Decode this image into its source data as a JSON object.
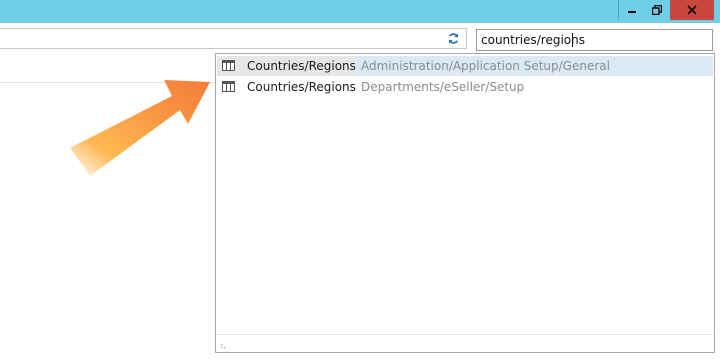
{
  "window": {
    "accent_color": "#6fcde6",
    "close_color": "#c9473e",
    "buttons": [
      "minimize-icon",
      "restore-icon",
      "close-icon"
    ]
  },
  "search": {
    "value": "countries/regions"
  },
  "results": [
    {
      "label": "Countries/Regions",
      "path": "Administration/Application Setup/General",
      "icon": "table-icon",
      "selected": true
    },
    {
      "label": "Countries/Regions",
      "path": "Departments/eSeller/Setup",
      "icon": "table-icon",
      "selected": false
    }
  ]
}
